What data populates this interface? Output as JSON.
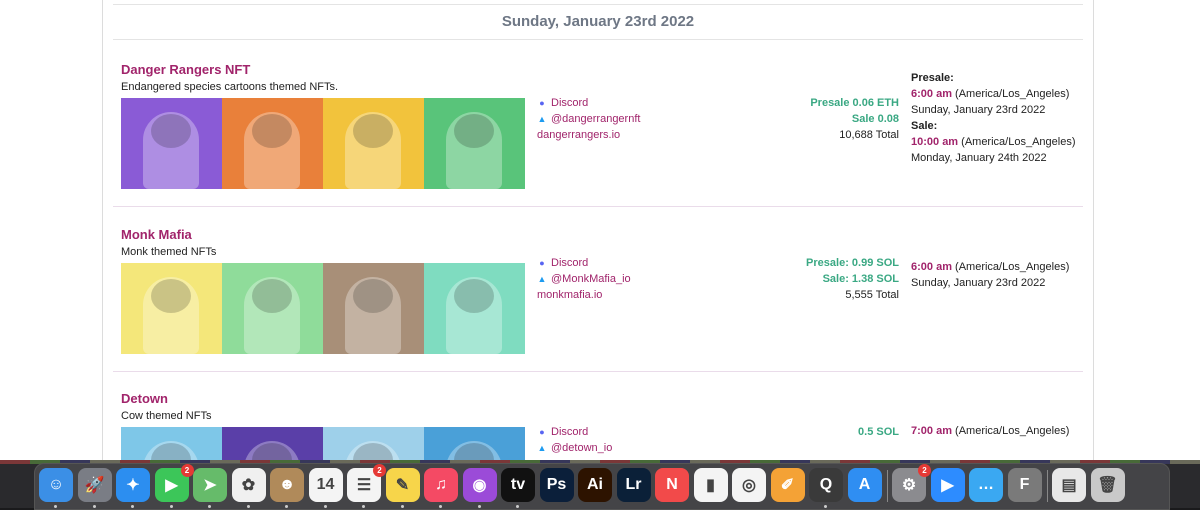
{
  "date_header": "Sunday, January 23rd 2022",
  "drops": [
    {
      "title": "Danger Rangers NFT",
      "description": "Endangered species cartoons themed NFTs.",
      "links": {
        "discord": "Discord",
        "twitter": "@dangerrangernft",
        "website": "dangerrangers.io"
      },
      "price_lines": [
        "Presale 0.06 ETH",
        "Sale 0.08"
      ],
      "total": "10,688 Total",
      "schedule": [
        {
          "label": "Presale:",
          "time": "6:00 am",
          "tz": "(America/Los_Angeles)",
          "date": "Sunday, January 23rd 2022"
        },
        {
          "label": "Sale:",
          "time": "10:00 am",
          "tz": "(America/Los_Angeles)",
          "date": "Monday, January 24th 2022"
        }
      ],
      "thumb_colors": [
        "#8a5bd6",
        "#e9803a",
        "#f2c33c",
        "#59c47a"
      ]
    },
    {
      "title": "Monk Mafia",
      "description": "Monk themed NFTs",
      "links": {
        "discord": "Discord",
        "twitter": "@MonkMafia_io",
        "website": "monkmafia.io"
      },
      "price_lines": [
        "Presale: 0.99 SOL",
        "Sale: 1.38 SOL"
      ],
      "total": "5,555 Total",
      "schedule": [
        {
          "label": "",
          "time": "6:00 am",
          "tz": "(America/Los_Angeles)",
          "date": "Sunday, January 23rd 2022"
        }
      ],
      "thumb_colors": [
        "#f4e77a",
        "#8fdc9a",
        "#a88f78",
        "#7fdcc0"
      ]
    },
    {
      "title": "Detown",
      "description": "Cow themed NFTs",
      "links": {
        "discord": "Discord",
        "twitter": "@detown_io",
        "website": ""
      },
      "price_lines": [
        "0.5 SOL"
      ],
      "total": "",
      "schedule": [
        {
          "label": "",
          "time": "7:00 am",
          "tz": "(America/Los_Angeles)",
          "date": ""
        }
      ],
      "thumb_colors": [
        "#7ec7e8",
        "#5a3fa8",
        "#9ed0ea",
        "#4aa0d8"
      ]
    }
  ],
  "dock": [
    {
      "name": "finder-icon",
      "glyph": "☺",
      "bg": "#3b8fe6",
      "badge": ""
    },
    {
      "name": "launchpad-icon",
      "glyph": "🚀",
      "bg": "#7a7d85",
      "badge": ""
    },
    {
      "name": "safari-icon",
      "glyph": "✦",
      "bg": "#2c8ef0",
      "badge": ""
    },
    {
      "name": "facetime-icon",
      "glyph": "▶",
      "bg": "#3cc659",
      "badge": "2"
    },
    {
      "name": "maps-icon",
      "glyph": "➤",
      "bg": "#66bb6a",
      "badge": ""
    },
    {
      "name": "photos-icon",
      "glyph": "✿",
      "bg": "#f0f0f0",
      "badge": ""
    },
    {
      "name": "contacts-icon",
      "glyph": "☻",
      "bg": "#b08a5a",
      "badge": ""
    },
    {
      "name": "calendar-icon",
      "glyph": "14",
      "bg": "#f4f4f4",
      "badge": ""
    },
    {
      "name": "reminders-icon",
      "glyph": "☰",
      "bg": "#f4f4f4",
      "badge": "2"
    },
    {
      "name": "notes-icon",
      "glyph": "✎",
      "bg": "#f7d54a",
      "badge": ""
    },
    {
      "name": "music-icon",
      "glyph": "♫",
      "bg": "#f44a64",
      "badge": ""
    },
    {
      "name": "podcasts-icon",
      "glyph": "◉",
      "bg": "#9b4bd8",
      "badge": ""
    },
    {
      "name": "appletv-icon",
      "glyph": "tv",
      "bg": "#111",
      "badge": ""
    },
    {
      "name": "photoshop-icon",
      "glyph": "Ps",
      "bg": "#0b1f3a",
      "badge": ""
    },
    {
      "name": "illustrator-icon",
      "glyph": "Ai",
      "bg": "#2d1300",
      "badge": ""
    },
    {
      "name": "lightroom-icon",
      "glyph": "Lr",
      "bg": "#0b2038",
      "badge": ""
    },
    {
      "name": "news-icon",
      "glyph": "N",
      "bg": "#f24a4a",
      "badge": ""
    },
    {
      "name": "numbers-icon",
      "glyph": "▮",
      "bg": "#f4f4f4",
      "badge": ""
    },
    {
      "name": "chrome-icon",
      "glyph": "◎",
      "bg": "#f4f4f4",
      "badge": ""
    },
    {
      "name": "pages-icon",
      "glyph": "✐",
      "bg": "#f4a236",
      "badge": ""
    },
    {
      "name": "quicktime-icon",
      "glyph": "Q",
      "bg": "#3a3a3a",
      "badge": ""
    },
    {
      "name": "appstore-icon",
      "glyph": "A",
      "bg": "#2f8ef2",
      "badge": ""
    },
    {
      "name": "systemprefs-icon",
      "glyph": "⚙",
      "bg": "#8b8b8f",
      "badge": "2"
    },
    {
      "name": "zoom-icon",
      "glyph": "▶",
      "bg": "#2d8cff",
      "badge": ""
    },
    {
      "name": "messages-icon",
      "glyph": "…",
      "bg": "#3aa8f2",
      "badge": ""
    },
    {
      "name": "fontbook-icon",
      "glyph": "F",
      "bg": "#7a7a7a",
      "badge": ""
    },
    {
      "name": "png-file-icon",
      "glyph": "▤",
      "bg": "#e8e8e8",
      "badge": ""
    },
    {
      "name": "trash-icon",
      "glyph": "🗑",
      "bg": "#c9c9c9",
      "badge": ""
    }
  ]
}
